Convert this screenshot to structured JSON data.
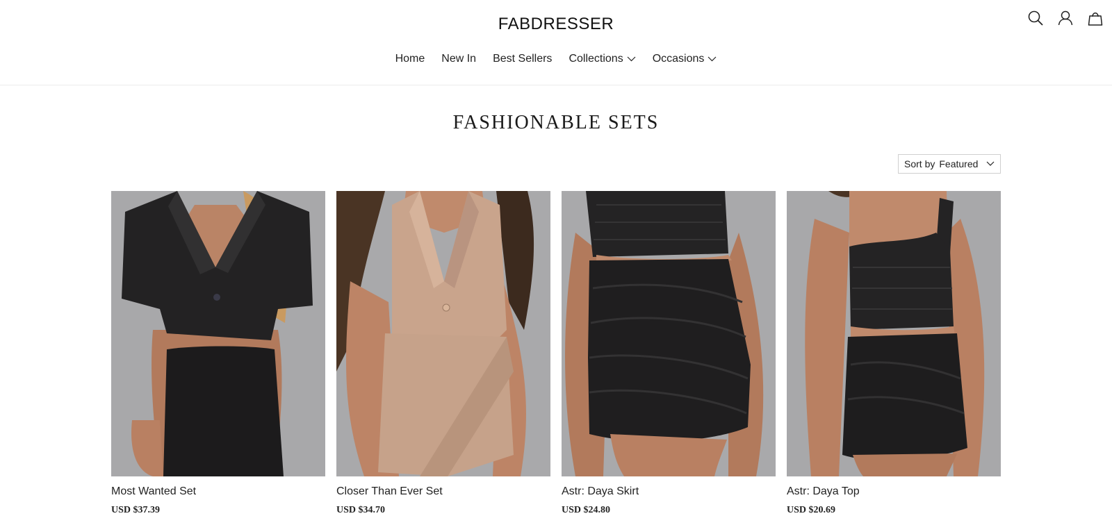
{
  "header": {
    "logo": "FABDRESSER",
    "icons": [
      "search-icon",
      "account-icon",
      "cart-icon"
    ]
  },
  "nav": {
    "items": [
      {
        "label": "Home",
        "dropdown": false
      },
      {
        "label": "New In",
        "dropdown": false
      },
      {
        "label": "Best Sellers",
        "dropdown": false
      },
      {
        "label": "Collections",
        "dropdown": true
      },
      {
        "label": "Occasions",
        "dropdown": true
      }
    ]
  },
  "page": {
    "title": "FASHIONABLE SETS"
  },
  "sort": {
    "label": "Sort by",
    "value": "Featured"
  },
  "products": [
    {
      "name": "Most Wanted Set",
      "price": "USD $37.39"
    },
    {
      "name": "Closer Than Ever Set",
      "price": "USD $34.70"
    },
    {
      "name": "Astr: Daya Skirt",
      "price": "USD $24.80"
    },
    {
      "name": "Astr: Daya Top",
      "price": "USD $20.69"
    }
  ],
  "colors": {
    "background": "#ffffff",
    "text": "#1a1a1a",
    "photo_wall": "#a9a9ab",
    "garment_black": "#1c1b1c",
    "garment_tan": "#c9a48c",
    "skin": "#b98062"
  }
}
